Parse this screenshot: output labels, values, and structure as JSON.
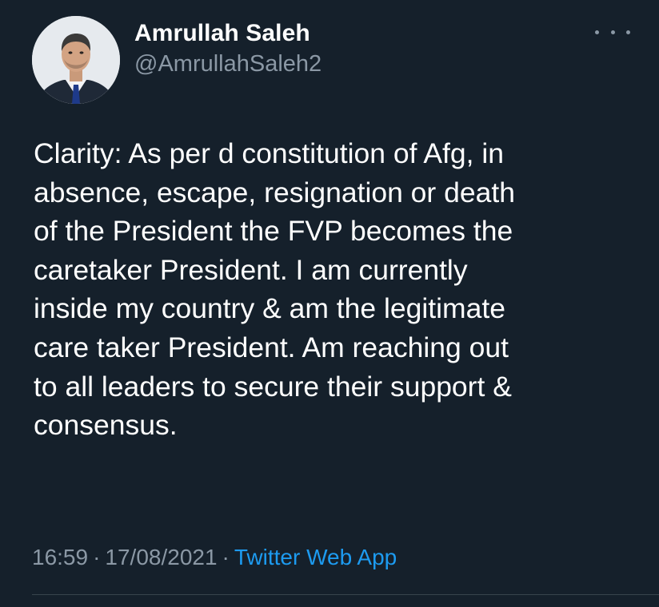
{
  "tweet": {
    "author": {
      "name": "Amrullah Saleh",
      "handle": "@AmrullahSaleh2",
      "avatar": "profile-photo"
    },
    "more_icon": "more-horizontal-icon",
    "text": "Clarity: As per d constitution of Afg, in\nabsence, escape, resignation or death\nof the President the FVP becomes the\ncaretaker President. I am currently\ninside my country & am the legitimate\ncare taker President. Am reaching out\nto all leaders to secure their support &\nconsensus.",
    "time": "16:59",
    "separator_1": "·",
    "date": "17/08/2021",
    "separator_2": "·",
    "source": "Twitter Web App"
  },
  "colors": {
    "background": "#15202b",
    "primary_text": "#ffffff",
    "secondary_text": "#8b98a5",
    "link": "#1d9bf0",
    "divider": "#38444d"
  }
}
